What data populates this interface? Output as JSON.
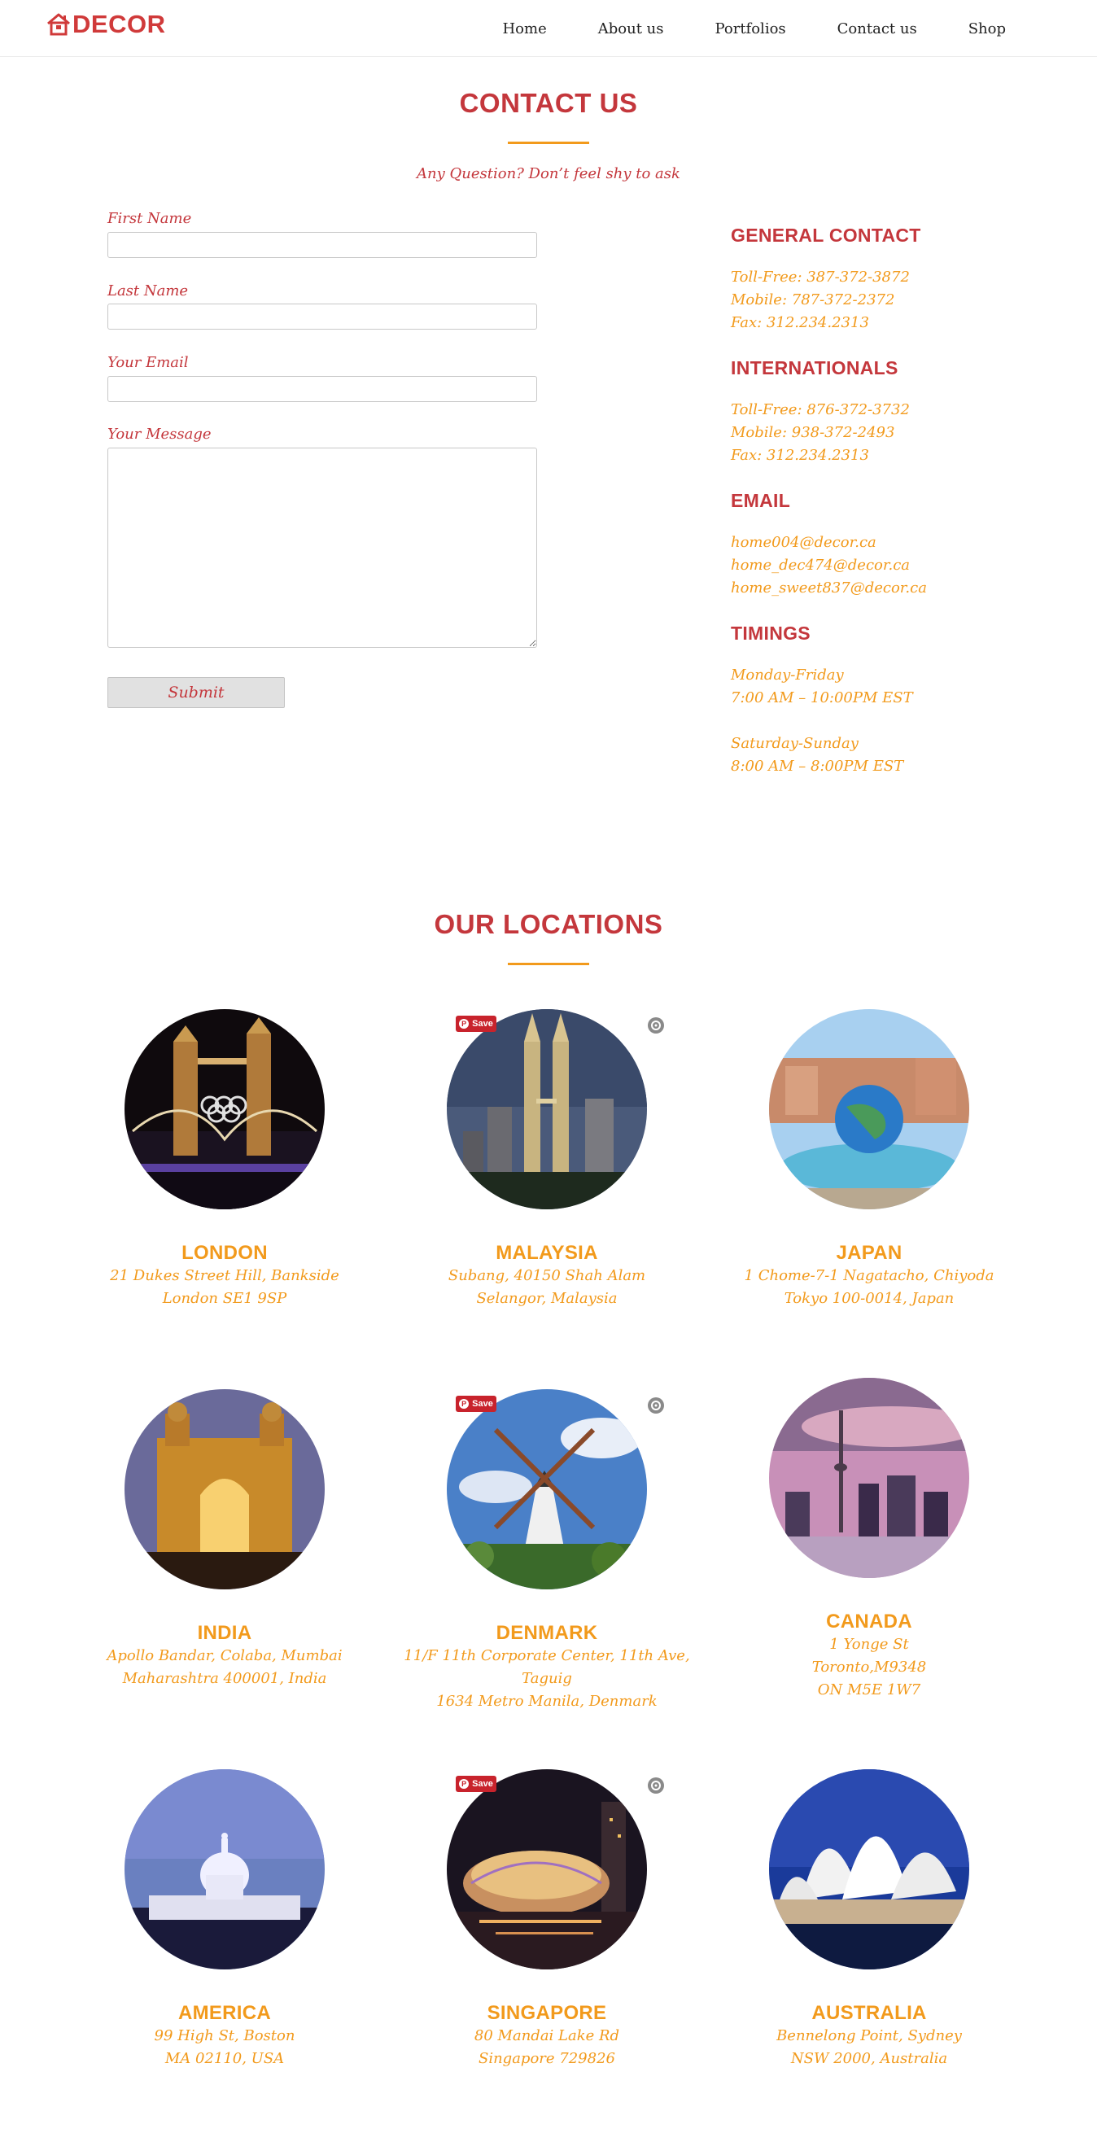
{
  "header": {
    "logo_text": "DECOR",
    "nav": [
      "Home",
      "About us",
      "Portfolios",
      "Contact us",
      "Shop"
    ]
  },
  "contact": {
    "title": "CONTACT US",
    "subtitle": "Any Question? Don’t feel shy to ask",
    "form": {
      "first_name_label": "First Name",
      "last_name_label": "Last Name",
      "email_label": "Your Email",
      "message_label": "Your Message",
      "first_name_value": "",
      "last_name_value": "",
      "email_value": "",
      "message_value": "",
      "submit_label": "Submit"
    },
    "info": {
      "general": {
        "heading": "GENERAL CONTACT",
        "lines": [
          "Toll-Free: 387-372-3872",
          "Mobile: 787-372-2372",
          "Fax: 312.234.2313"
        ]
      },
      "international": {
        "heading": "INTERNATIONALS",
        "lines": [
          "Toll-Free: 876-372-3732",
          "Mobile: 938-372-2493",
          "Fax: 312.234.2313"
        ]
      },
      "email": {
        "heading": "EMAIL",
        "lines": [
          "home004@decor.ca",
          "home_dec474@decor.ca",
          "home_sweet837@decor.ca"
        ]
      },
      "timings": {
        "heading": "TIMINGS",
        "weekday_days": "Monday-Friday",
        "weekday_hours": "7:00 AM – 10:00PM EST",
        "weekend_days": "Saturday-Sunday",
        "weekend_hours": "8:00 AM – 8:00PM EST"
      }
    }
  },
  "locations": {
    "title": "OUR LOCATIONS",
    "save_label": "Save",
    "items": [
      {
        "name": "LONDON",
        "lines": [
          "21 Dukes Street Hill, Bankside",
          "London SE1 9SP"
        ]
      },
      {
        "name": "MALAYSIA",
        "lines": [
          "Subang, 40150 Shah Alam",
          "Selangor, Malaysia"
        ]
      },
      {
        "name": "JAPAN",
        "lines": [
          "1 Chome-7-1 Nagatacho, Chiyoda",
          "Tokyo 100-0014, Japan"
        ]
      },
      {
        "name": "INDIA",
        "lines": [
          "Apollo Bandar, Colaba, Mumbai",
          "Maharashtra 400001, India"
        ]
      },
      {
        "name": "DENMARK",
        "lines": [
          "11/F 11th Corporate Center, 11th Ave, Taguig",
          "1634 Metro Manila, Denmark"
        ]
      },
      {
        "name": "CANADA",
        "lines": [
          "1 Yonge St",
          "Toronto,M9348",
          "ON M5E 1W7"
        ]
      },
      {
        "name": "AMERICA",
        "lines": [
          "99 High St, Boston",
          "MA 02110, USA"
        ]
      },
      {
        "name": "SINGAPORE",
        "lines": [
          "80 Mandai Lake Rd",
          "Singapore 729826"
        ]
      },
      {
        "name": "AUSTRALIA",
        "lines": [
          "Bennelong Point, Sydney",
          "NSW 2000, Australia"
        ]
      }
    ]
  }
}
